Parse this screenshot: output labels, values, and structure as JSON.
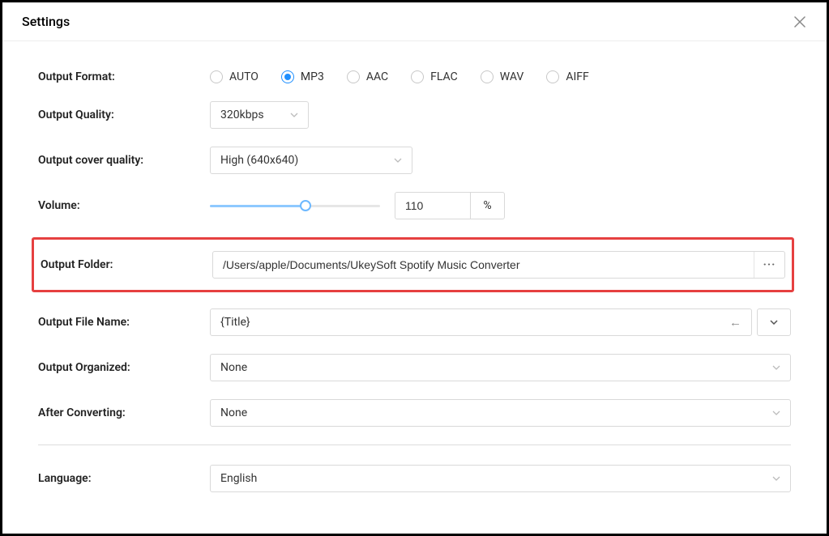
{
  "header": {
    "title": "Settings"
  },
  "labels": {
    "output_format": "Output Format:",
    "output_quality": "Output Quality:",
    "output_cover_quality": "Output cover quality:",
    "volume": "Volume:",
    "output_folder": "Output Folder:",
    "output_file_name": "Output File Name:",
    "output_organized": "Output Organized:",
    "after_converting": "After Converting:",
    "language": "Language:"
  },
  "format_options": {
    "auto": "AUTO",
    "mp3": "MP3",
    "aac": "AAC",
    "flac": "FLAC",
    "wav": "WAV",
    "aiff": "AIFF",
    "selected": "mp3"
  },
  "output_quality": {
    "value": "320kbps"
  },
  "cover_quality": {
    "value": "High (640x640)"
  },
  "volume": {
    "value": "110",
    "suffix": "%",
    "fill_percent": 56
  },
  "output_folder": {
    "path": "/Users/apple/Documents/UkeySoft Spotify Music Converter"
  },
  "output_file_name": {
    "value": "{Title}"
  },
  "output_organized": {
    "value": "None"
  },
  "after_converting": {
    "value": "None"
  },
  "language": {
    "value": "English"
  }
}
